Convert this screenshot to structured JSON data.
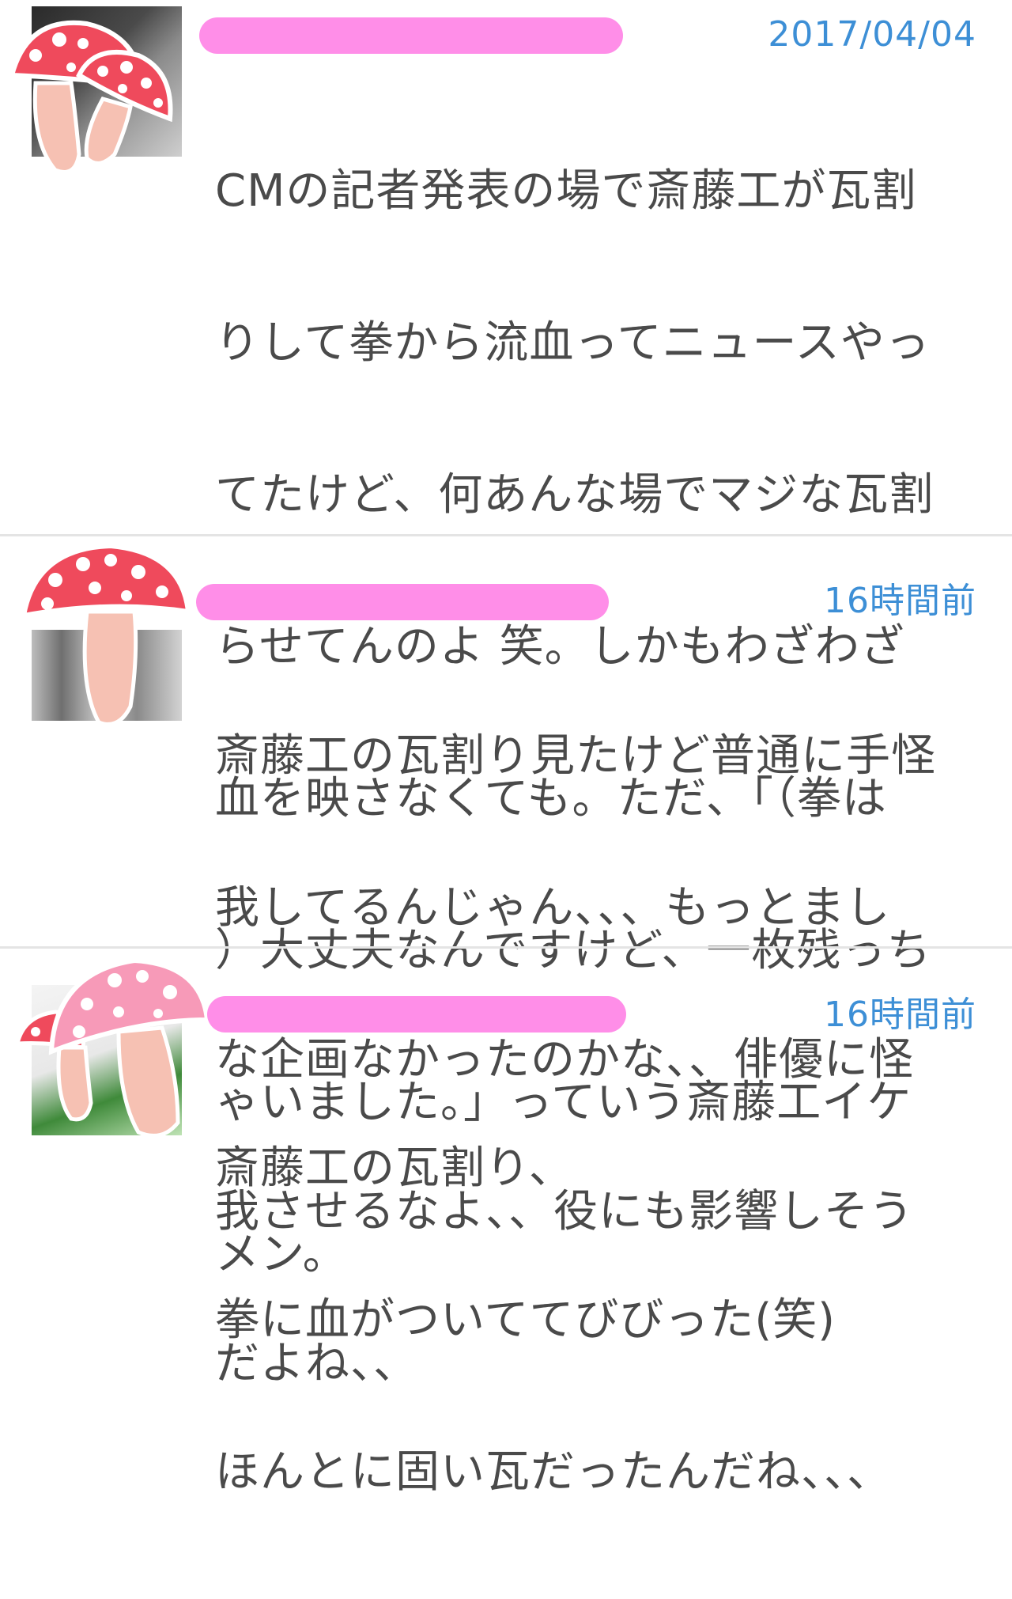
{
  "comments": [
    {
      "timestamp": "2017/04/04",
      "lines": [
        "CMの記者発表の場で斎藤工が瓦割",
        "りして拳から流血ってニュースやっ",
        "てたけど、何あんな場でマジな瓦割",
        "らせてんのよ 笑。しかもわざわざ",
        "血を映さなくても。ただ、「（拳は",
        "）大丈夫なんですけど、一枚残っち",
        "ゃいました。」っていう斎藤工イケ",
        "メン。"
      ]
    },
    {
      "timestamp": "16時間前",
      "lines": [
        "斎藤工の瓦割り見たけど普通に手怪",
        "我してるんじゃん、、、もっとまし",
        "な企画なかったのかな、、俳優に怪",
        "我させるなよ、、役にも影響しそう",
        "だよね、、"
      ]
    },
    {
      "timestamp": "16時間前",
      "lines": [
        "斎藤工の瓦割り、",
        "拳に血がついててびびった(笑)",
        "ほんとに固い瓦だったんだね、、、"
      ]
    }
  ],
  "colors": {
    "timestamp": "#3d8fd6",
    "body_text": "#4a4a4a",
    "username_redaction": "#ff8ee8",
    "mushroom_red": "#ef4a5c",
    "mushroom_pink": "#f79ab8",
    "mushroom_stem": "#f6c1b3",
    "divider": "#e4e4e4"
  },
  "icons": [
    "mushroom-sticker-icon"
  ]
}
